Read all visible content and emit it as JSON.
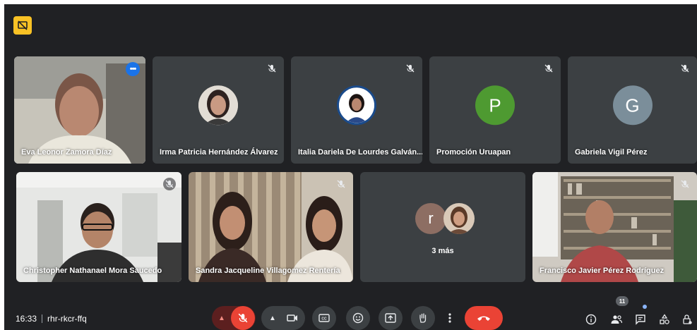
{
  "meeting": {
    "time": "16:33",
    "code": "rhr-rkcr-ffq",
    "participants_count": "11"
  },
  "top_row": [
    {
      "name": "Eva Leonor Zamora Díaz",
      "type": "video"
    },
    {
      "name": "Irma Patricia Hernández Álvarez",
      "type": "photo"
    },
    {
      "name": "Italia Dariela De Lourdes Galván...",
      "type": "photo"
    },
    {
      "name": "Promoción Uruapan",
      "type": "letter",
      "letter": "P",
      "color": "#4e9a31"
    },
    {
      "name": "Gabriela Vigil Pérez",
      "type": "letter",
      "letter": "G",
      "color": "#7b8e9a"
    }
  ],
  "bottom_row": [
    {
      "name": "Christopher Nathanael Mora Saucedo",
      "type": "video"
    },
    {
      "name": "Sandra Jacqueline Villagomez Rentería",
      "type": "video"
    },
    {
      "name": "3 más",
      "type": "overflow",
      "letter": "r",
      "color": "#8d6e63"
    },
    {
      "name": "Francisco Javier Pérez Rodríguez",
      "type": "video"
    }
  ],
  "colors": {
    "background": "#202124",
    "tile": "#3c4043",
    "end_call": "#ea4335",
    "active_border": "#8ab4f8",
    "badge": "#f9c225"
  },
  "icons": {
    "badge": "presentation-off-icon",
    "mute": "mic-off-icon",
    "more": "more-dots-icon"
  }
}
